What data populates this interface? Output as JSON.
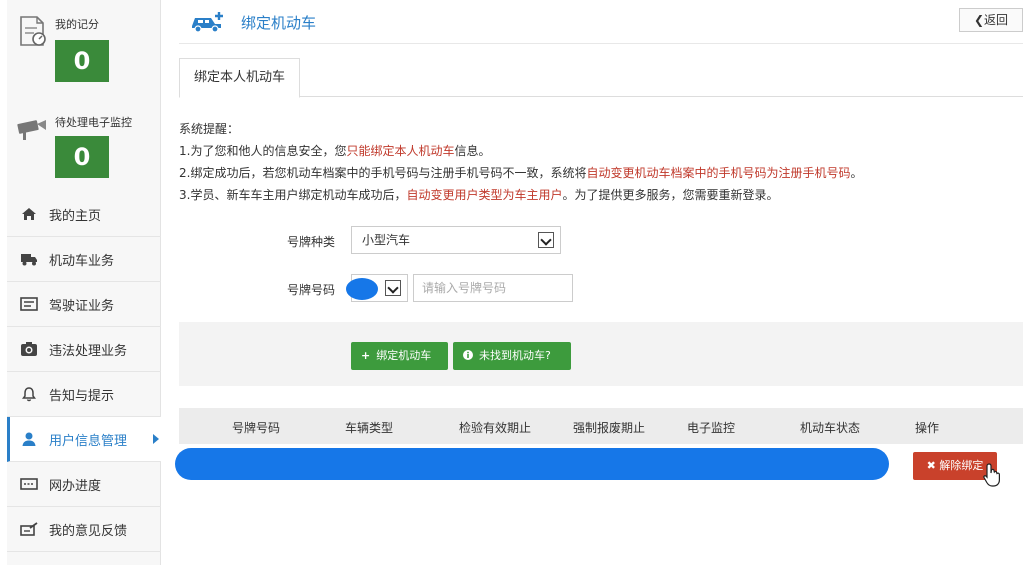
{
  "sidebar": {
    "stats": [
      {
        "label": "我的记分",
        "value": "0",
        "icon": "score-document-icon"
      },
      {
        "label": "待处理电子监控",
        "value": "0",
        "icon": "camera-monitor-icon"
      }
    ],
    "menu": [
      {
        "label": "我的主页",
        "icon": "home-icon"
      },
      {
        "label": "机动车业务",
        "icon": "truck-icon"
      },
      {
        "label": "驾驶证业务",
        "icon": "license-card-icon"
      },
      {
        "label": "违法处理业务",
        "icon": "camera-icon"
      },
      {
        "label": "告知与提示",
        "icon": "bell-icon"
      },
      {
        "label": "用户信息管理",
        "icon": "user-icon",
        "active": true
      },
      {
        "label": "网办进度",
        "icon": "progress-icon"
      },
      {
        "label": "我的意见反馈",
        "icon": "feedback-icon"
      }
    ]
  },
  "header": {
    "title": "绑定机动车",
    "back_label": "❮返回",
    "icon": "car-plus-icon"
  },
  "tabs": [
    {
      "label": "绑定本人机动车",
      "active": true
    }
  ],
  "notice": {
    "heading": "系统提醒：",
    "line1_a": "1.为了您和他人的信息安全，您",
    "line1_red": "只能绑定本人机动车",
    "line1_b": "信息。",
    "line2_a": "2.绑定成功后，若您机动车档案中的手机号码与注册手机号码不一致，系统将",
    "line2_red": "自动变更机动车档案中的手机号码为注册手机号码",
    "line2_b": "。",
    "line3_a": "3.学员、新车车主用户绑定机动车成功后，",
    "line3_red": "自动变更用户类型为车主用户",
    "line3_b": "。为了提供更多服务，您需要重新登录。"
  },
  "form": {
    "plate_type_label": "号牌种类",
    "plate_type_value": "小型汽车",
    "plate_number_label": "号牌号码",
    "plate_number_placeholder": "请输入号牌号码"
  },
  "actions": {
    "bind_label": "绑定机动车",
    "not_found_label": "未找到机动车?"
  },
  "table": {
    "headers": [
      "号牌号码",
      "车辆类型",
      "检验有效期止",
      "强制报废期止",
      "电子监控",
      "机动车状态",
      "操作"
    ],
    "unbind_label": "解除绑定"
  },
  "colors": {
    "accent_blue": "#2a7fc8",
    "green": "#3d9b3d",
    "red": "#c9412b",
    "redaction": "#1677e8"
  }
}
